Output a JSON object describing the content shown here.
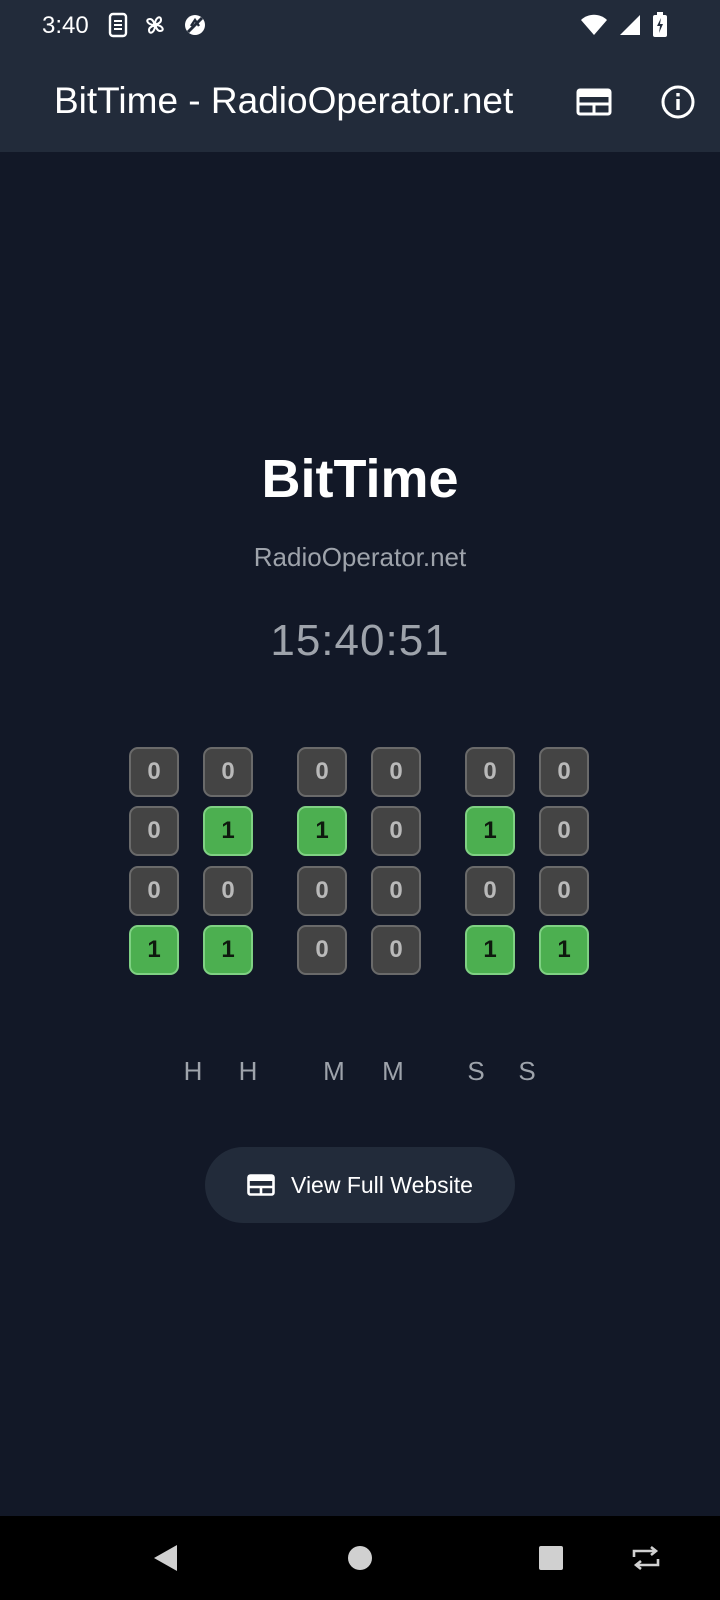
{
  "status_bar": {
    "time": "3:40",
    "left_icons": [
      "sim-icon",
      "pinwheel-icon",
      "no-sync-icon"
    ],
    "right_icons": [
      "wifi-icon",
      "signal-icon",
      "battery-charging-icon"
    ]
  },
  "app_bar": {
    "title": "BitTime - RadioOperator.net",
    "actions": [
      {
        "name": "web-view-icon"
      },
      {
        "name": "info-icon"
      }
    ]
  },
  "main": {
    "title": "BitTime",
    "subtitle": "RadioOperator.net",
    "time": "15:40:51"
  },
  "bit_grid": {
    "columns": [
      {
        "label": "H",
        "bits": [
          "0",
          "0",
          "0",
          "1"
        ]
      },
      {
        "label": "H",
        "bits": [
          "0",
          "1",
          "0",
          "1"
        ]
      },
      {
        "label": "M",
        "bits": [
          "0",
          "1",
          "0",
          "0"
        ]
      },
      {
        "label": "M",
        "bits": [
          "0",
          "0",
          "0",
          "0"
        ]
      },
      {
        "label": "S",
        "bits": [
          "0",
          "1",
          "0",
          "1"
        ]
      },
      {
        "label": "S",
        "bits": [
          "0",
          "0",
          "0",
          "1"
        ]
      }
    ],
    "on_color": "#4caf50",
    "off_color": "#444444"
  },
  "website_button": {
    "label": "View Full Website",
    "icon": "web-view-icon"
  },
  "nav_bar": {
    "buttons": [
      "back-icon",
      "home-icon",
      "recents-icon",
      "rotate-icon"
    ]
  },
  "colors": {
    "background": "#121827",
    "bar": "#222b3a",
    "muted_text": "#9ea3ab"
  }
}
